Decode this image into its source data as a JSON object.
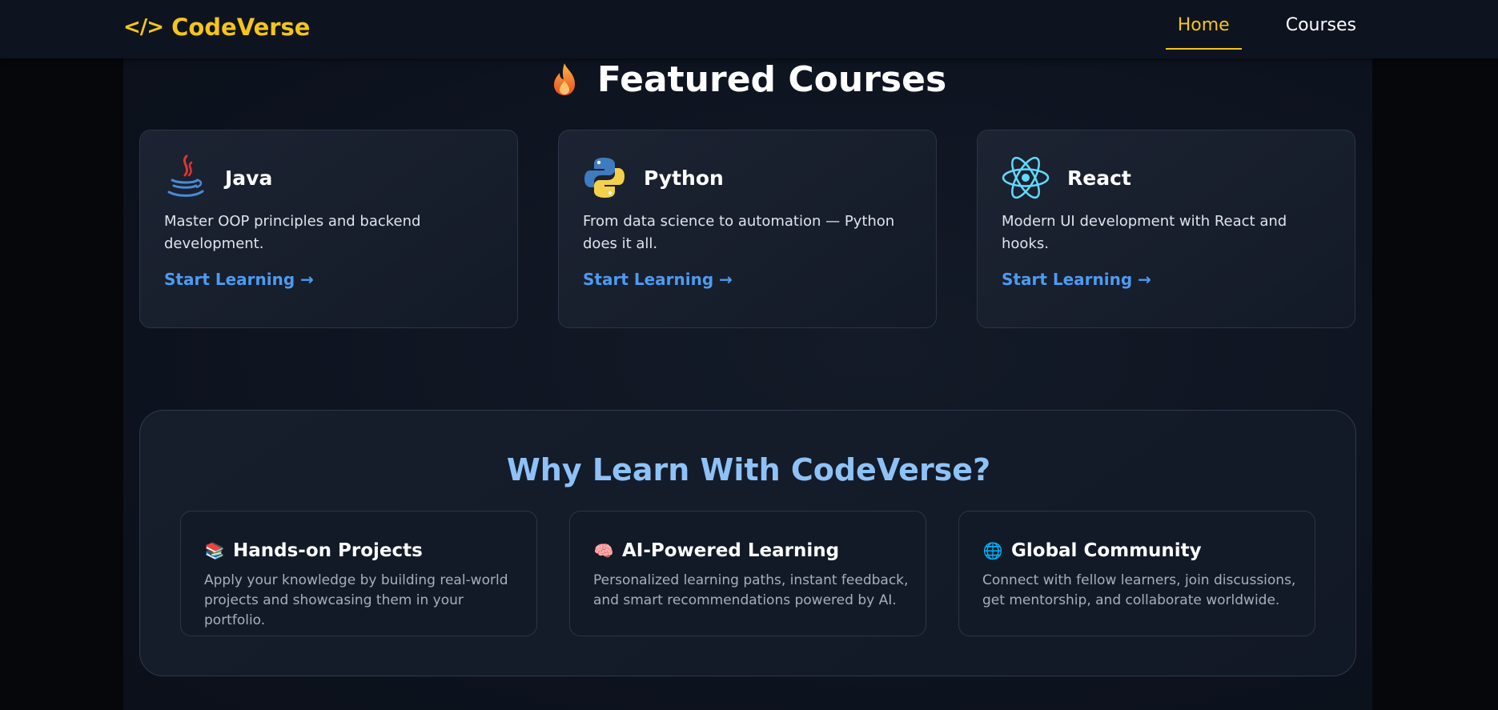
{
  "brand": {
    "name": "CodeVerse",
    "icon": "code-brackets-icon",
    "color": "#f5c518"
  },
  "nav": {
    "items": [
      {
        "label": "Home",
        "active": true
      },
      {
        "label": "Courses",
        "active": false
      }
    ]
  },
  "featured": {
    "title": "Featured Courses",
    "icon": "fire-icon",
    "courses": [
      {
        "name": "Java",
        "icon": "java-icon",
        "description": "Master OOP principles and backend development.",
        "link": "Start Learning →"
      },
      {
        "name": "Python",
        "icon": "python-icon",
        "description": "From data science to automation — Python does it all.",
        "link": "Start Learning →"
      },
      {
        "name": "React",
        "icon": "react-icon",
        "description": "Modern UI development with React and hooks.",
        "link": "Start Learning →"
      }
    ]
  },
  "why": {
    "title": "Why Learn With CodeVerse?",
    "features": [
      {
        "icon": "books-icon",
        "glyph": "📚",
        "title": "Hands-on Projects",
        "description": "Apply your knowledge by building real-world projects and showcasing them in your portfolio."
      },
      {
        "icon": "brain-icon",
        "glyph": "🧠",
        "title": "AI-Powered Learning",
        "description": "Personalized learning paths, instant feedback, and smart recommendations powered by AI."
      },
      {
        "icon": "globe-icon",
        "glyph": "🌐",
        "title": "Global Community",
        "description": "Connect with fellow learners, join discussions, get mentorship, and collaborate worldwide."
      }
    ]
  },
  "colors": {
    "accent": "#f5c518",
    "link": "#4d9bf0",
    "heading_blue": "#8ec2f7",
    "background": "#0e1420"
  }
}
